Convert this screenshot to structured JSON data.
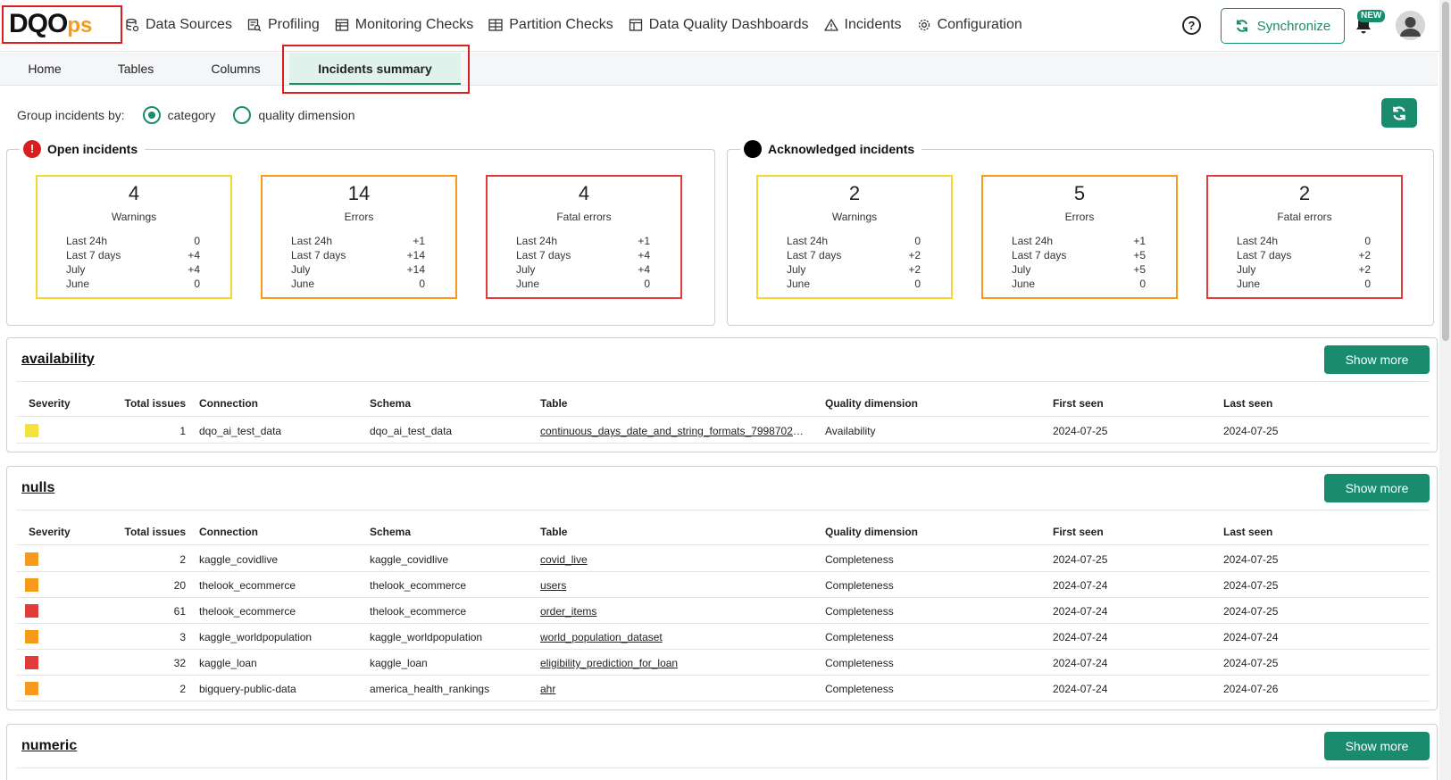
{
  "logo": {
    "main": "DQO",
    "suffix": "ps"
  },
  "nav": [
    {
      "id": "data-sources",
      "label": "Data Sources",
      "icon": "database-icon"
    },
    {
      "id": "profiling",
      "label": "Profiling",
      "icon": "profiling-icon"
    },
    {
      "id": "monitoring-checks",
      "label": "Monitoring Checks",
      "icon": "table-icon"
    },
    {
      "id": "partition-checks",
      "label": "Partition Checks",
      "icon": "partition-icon"
    },
    {
      "id": "data-quality-dashboards",
      "label": "Data Quality Dashboards",
      "icon": "dashboard-icon"
    },
    {
      "id": "incidents",
      "label": "Incidents",
      "icon": "warning-icon"
    },
    {
      "id": "configuration",
      "label": "Configuration",
      "icon": "gear-icon"
    }
  ],
  "header": {
    "help_label": "?",
    "sync_label": "Synchronize",
    "new_badge": "NEW"
  },
  "tabs": [
    {
      "label": "Home"
    },
    {
      "label": "Tables"
    },
    {
      "label": "Columns"
    },
    {
      "label": "Incidents summary",
      "active": true
    }
  ],
  "groupby": {
    "label": "Group incidents by:",
    "option1": "category",
    "option2": "quality dimension",
    "selected": "category"
  },
  "open": {
    "title": "Open incidents",
    "icon_label": "!",
    "cards": [
      {
        "type": "warn",
        "count": "4",
        "label": "Warnings",
        "rows": [
          [
            "Last 24h",
            "0"
          ],
          [
            "Last 7 days",
            "+4"
          ],
          [
            "July",
            "+4"
          ],
          [
            "June",
            "0"
          ]
        ]
      },
      {
        "type": "err",
        "count": "14",
        "label": "Errors",
        "rows": [
          [
            "Last 24h",
            "+1"
          ],
          [
            "Last 7 days",
            "+14"
          ],
          [
            "July",
            "+14"
          ],
          [
            "June",
            "0"
          ]
        ]
      },
      {
        "type": "fatal",
        "count": "4",
        "label": "Fatal errors",
        "rows": [
          [
            "Last 24h",
            "+1"
          ],
          [
            "Last 7 days",
            "+4"
          ],
          [
            "July",
            "+4"
          ],
          [
            "June",
            "0"
          ]
        ]
      }
    ]
  },
  "acknowledged": {
    "title": "Acknowledged incidents",
    "cards": [
      {
        "type": "warn",
        "count": "2",
        "label": "Warnings",
        "rows": [
          [
            "Last 24h",
            "0"
          ],
          [
            "Last 7 days",
            "+2"
          ],
          [
            "July",
            "+2"
          ],
          [
            "June",
            "0"
          ]
        ]
      },
      {
        "type": "err",
        "count": "5",
        "label": "Errors",
        "rows": [
          [
            "Last 24h",
            "+1"
          ],
          [
            "Last 7 days",
            "+5"
          ],
          [
            "July",
            "+5"
          ],
          [
            "June",
            "0"
          ]
        ]
      },
      {
        "type": "fatal",
        "count": "2",
        "label": "Fatal errors",
        "rows": [
          [
            "Last 24h",
            "0"
          ],
          [
            "Last 7 days",
            "+2"
          ],
          [
            "July",
            "+2"
          ],
          [
            "June",
            "0"
          ]
        ]
      }
    ]
  },
  "table_headers": {
    "severity": "Severity",
    "total": "Total issues",
    "connection": "Connection",
    "schema": "Schema",
    "table": "Table",
    "dimension": "Quality dimension",
    "first_seen": "First seen",
    "last_seen": "Last seen"
  },
  "show_more_label": "Show more",
  "sections": [
    {
      "title": "availability",
      "rows": [
        {
          "severity": "warning",
          "total": "1",
          "connection": "dqo_ai_test_data",
          "schema": "dqo_ai_test_data",
          "table": "continuous_days_date_and_string_formats_799870218...",
          "dimension": "Availability",
          "first_seen": "2024-07-25",
          "last_seen": "2024-07-25"
        }
      ]
    },
    {
      "title": "nulls",
      "rows": [
        {
          "severity": "error",
          "total": "2",
          "connection": "kaggle_covidlive",
          "schema": "kaggle_covidlive",
          "table": "covid_live",
          "dimension": "Completeness",
          "first_seen": "2024-07-25",
          "last_seen": "2024-07-25"
        },
        {
          "severity": "error",
          "total": "20",
          "connection": "thelook_ecommerce",
          "schema": "thelook_ecommerce",
          "table": "users",
          "dimension": "Completeness",
          "first_seen": "2024-07-24",
          "last_seen": "2024-07-25"
        },
        {
          "severity": "fatal",
          "total": "61",
          "connection": "thelook_ecommerce",
          "schema": "thelook_ecommerce",
          "table": "order_items",
          "dimension": "Completeness",
          "first_seen": "2024-07-24",
          "last_seen": "2024-07-25"
        },
        {
          "severity": "error",
          "total": "3",
          "connection": "kaggle_worldpopulation",
          "schema": "kaggle_worldpopulation",
          "table": "world_population_dataset",
          "dimension": "Completeness",
          "first_seen": "2024-07-24",
          "last_seen": "2024-07-24"
        },
        {
          "severity": "fatal",
          "total": "32",
          "connection": "kaggle_loan",
          "schema": "kaggle_loan",
          "table": "eligibility_prediction_for_loan",
          "dimension": "Completeness",
          "first_seen": "2024-07-24",
          "last_seen": "2024-07-25"
        },
        {
          "severity": "error",
          "total": "2",
          "connection": "bigquery-public-data",
          "schema": "america_health_rankings",
          "table": "ahr",
          "dimension": "Completeness",
          "first_seen": "2024-07-24",
          "last_seen": "2024-07-26"
        }
      ]
    },
    {
      "title": "numeric",
      "rows": []
    }
  ],
  "colors": {
    "accent": "#1a8c6e",
    "warning": "#f4e23a",
    "error": "#f59a1b",
    "fatal": "#e23b3b",
    "highlight": "#d81e1e"
  }
}
